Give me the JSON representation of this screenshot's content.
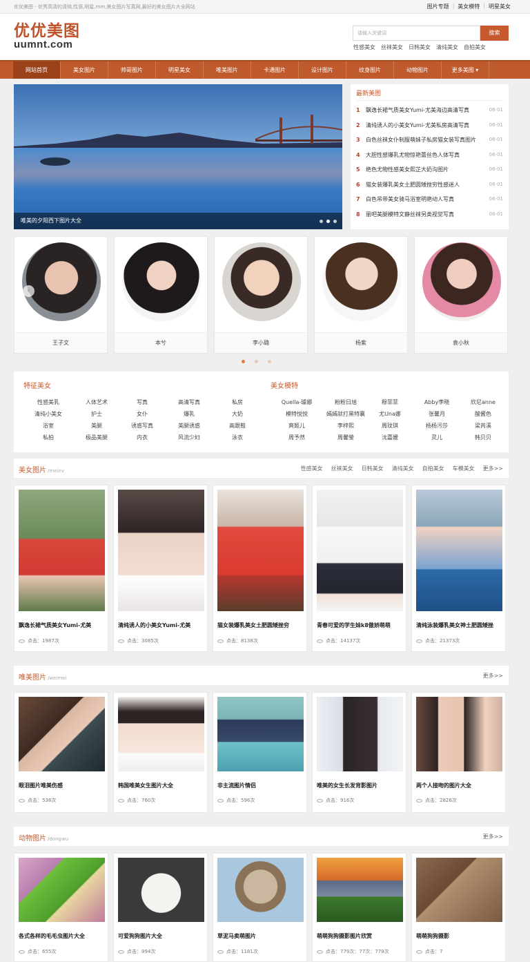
{
  "topbar": {
    "intro": "优优美图 - 优秀高清的清纯,性感,明星,mm,美女图片写真网,最好的美女图片大全网站",
    "links": [
      "图片专题",
      "美女模特",
      "明星美女"
    ]
  },
  "header": {
    "logo_cn": "优优美图",
    "logo_en": "uumnt.com",
    "search_placeholder": "请输入关键词",
    "search_button": "搜索",
    "hotwords": [
      "性感美女",
      "丝袜美女",
      "日韩美女",
      "清纯美女",
      "自拍美女"
    ]
  },
  "nav": [
    "网站首页",
    "美女图片",
    "帅哥图片",
    "明星美女",
    "唯美图片",
    "卡通图片",
    "设计图片",
    "纹身图片",
    "动物图片",
    "更多美图"
  ],
  "banner": {
    "caption": "唯美的夕阳西下图片大全"
  },
  "latest": {
    "title": "最新美图",
    "items": [
      {
        "n": "1",
        "t": "飘逸长裙气质美女Yumi-尤美海边高清写真",
        "d": "06-01"
      },
      {
        "n": "2",
        "t": "清纯诱人的小美女Yumi-尤美私房高清写真",
        "d": "06-01"
      },
      {
        "n": "3",
        "t": "白色丝袜女仆制服萌妹子私房猫女装写真图片",
        "d": "06-01"
      },
      {
        "n": "4",
        "t": "大胆性感爆乳尤物惊艳蕾丝色人体写真",
        "d": "06-01"
      },
      {
        "n": "5",
        "t": "绝色尤物性感美女熙芷大奶沟图片",
        "d": "06-01"
      },
      {
        "n": "6",
        "t": "猫女装爆乳美女土肥圆矮挫穷性感迷人",
        "d": "06-01"
      },
      {
        "n": "7",
        "t": "白色吊带美女骑马浴室明艳动人写真",
        "d": "06-01"
      },
      {
        "n": "8",
        "t": "丽吧美腿模特文静丝袜另类视觉写真",
        "d": "06-01"
      }
    ]
  },
  "stars": [
    {
      "name": "王子文"
    },
    {
      "name": "本兮"
    },
    {
      "name": "李小璐"
    },
    {
      "name": "杨紫"
    },
    {
      "name": "袁小秋"
    }
  ],
  "tags": {
    "left_title": "特征美女",
    "right_title": "美女模特",
    "left_cols": [
      [
        "性感美乳",
        "清纯小美女",
        "浴室",
        "私拍"
      ],
      [
        "人体艺术",
        "护士",
        "美腿",
        "极品美腿"
      ],
      [
        "写真",
        "女仆",
        "诱惑写真",
        "内衣"
      ],
      [
        "高清写真",
        "爆乳",
        "美腿诱惑",
        "风流少妇"
      ],
      [
        "私房",
        "大奶",
        "高跟鞋",
        "泳衣"
      ]
    ],
    "right_cols": [
      [
        "Quella-璩娜",
        "模特悦悦",
        "爽姬儿",
        "周予然"
      ],
      [
        "粉粉日旭",
        "嫣嫣就打黑特襄",
        "李梓熙",
        "周馨瑩"
      ],
      [
        "穆菲菲",
        "尤Una娜",
        "周玟琪",
        "沈嘉媛"
      ],
      [
        "Abby李晓",
        "张馨月",
        "杨杨污莎",
        "灵儿"
      ],
      [
        "欣尼anne",
        "酸酱色",
        "梁芮溪",
        "韩贝贝"
      ]
    ]
  },
  "section_beauty": {
    "title": "美女图片",
    "sub": "/meinv",
    "links": [
      "性感美女",
      "丝袜美女",
      "日韩美女",
      "清纯美女",
      "自拍美女",
      "车模美女",
      "更多>>"
    ],
    "cards": [
      {
        "title": "飘逸长裙气质美女Yumi-尤美",
        "count": "点击：1987次"
      },
      {
        "title": "清纯诱人的小美女Yumi-尤美",
        "count": "点击：3085次"
      },
      {
        "title": "猫女装爆乳美女土肥圆矮挫穷",
        "count": "点击：8138次"
      },
      {
        "title": "青春可爱的学生妹k8傲娇萌萌",
        "count": "点击：14137次"
      },
      {
        "title": "清纯泳装爆乳美女神土肥圆矮挫",
        "count": "点击：21373次"
      }
    ]
  },
  "section_weimei": {
    "title": "唯美图片",
    "sub": "/weimei",
    "more": "更多>>",
    "cards": [
      {
        "title": "眼泪图片唯美伤感",
        "count": "点击：538次"
      },
      {
        "title": "韩国唯美女生图片大全",
        "count": "点击：760次"
      },
      {
        "title": "非主流图片情侣",
        "count": "点击：596次"
      },
      {
        "title": "唯美的女生长发背影图片",
        "count": "点击：916次"
      },
      {
        "title": "两个人接吻的图片大全",
        "count": "点击：2826次"
      }
    ]
  },
  "section_animal": {
    "title": "动物图片",
    "sub": "/dongwu",
    "more": "更多>>",
    "cards": [
      {
        "title": "各式各样的毛毛虫图片大全",
        "count": "点击：655次"
      },
      {
        "title": "可爱狗狗图片大全",
        "count": "点击：994次"
      },
      {
        "title": "草泥马卖萌图片",
        "count": "点击：1181次"
      },
      {
        "title": "萌萌狗狗摄影图片欣赏",
        "count": "点击：779次：77次：779次"
      },
      {
        "title": "萌萌狗狗摄影",
        "count": "点击：7"
      }
    ]
  },
  "colors": {
    "accent": "#c65a2e",
    "nav": "#bf5a2d",
    "nav_active": "#9c421a"
  }
}
